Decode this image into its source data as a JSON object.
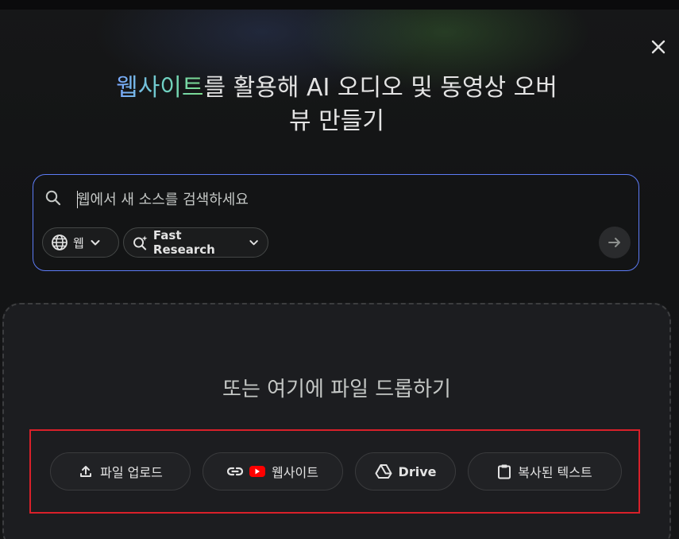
{
  "dialog": {
    "close_label": "close",
    "headline_highlight": "웹사이트",
    "headline_line1_rest": "를 활용해 AI 오디오 및 동영상 오버",
    "headline_line2": "뷰 만들기"
  },
  "search": {
    "placeholder": "웹에서 새 소스를 검색하세요",
    "value": "",
    "source_chip": "웹",
    "mode_chip": "Fast Research"
  },
  "drop_zone": {
    "title": "또는 여기에 파일 드롭하기",
    "buttons": {
      "upload": "파일 업로드",
      "website": "웹사이트",
      "drive": "Drive",
      "paste": "복사된 텍스트"
    }
  },
  "icons": {
    "close": "close-icon",
    "search": "search-icon",
    "globe": "globe-icon",
    "chevron": "chevron-down-icon",
    "research": "sparkle-search-icon",
    "arrow": "arrow-right-icon",
    "upload": "upload-icon",
    "link": "link-icon",
    "youtube": "youtube-icon",
    "drive": "drive-icon",
    "clipboard": "clipboard-icon"
  },
  "colors": {
    "accent_border": "#5d7cf6",
    "highlight_box": "#d9202a",
    "youtube_red": "#ff0000"
  }
}
